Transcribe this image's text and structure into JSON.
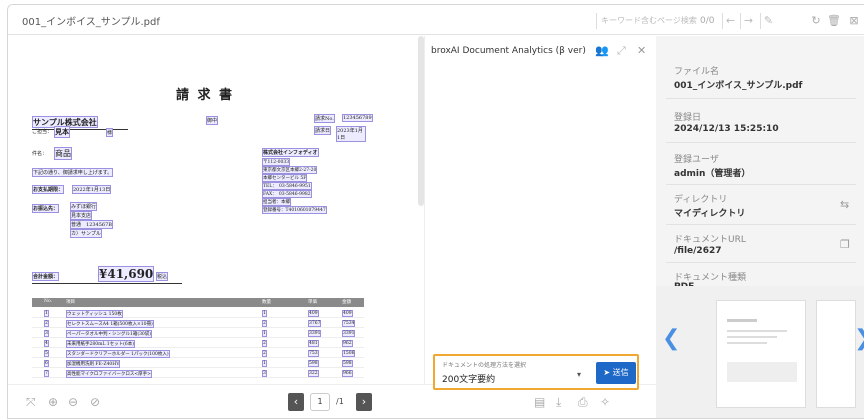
{
  "file_name": "001_インボイス_サンプル.pdf",
  "search": {
    "placeholder": "キーワード含むページ検索",
    "count": "0/0"
  },
  "doc": {
    "title": "請 求 書",
    "company": "サンプル株式会社",
    "company_suffix": "御中",
    "attn_label": "ご担当：",
    "attn_name": "見本",
    "attn_suffix": "様",
    "inv_no_label": "請求No.",
    "inv_no": "123456789",
    "inv_date_label": "請求日",
    "inv_date": "2023年1月1日",
    "subject_label": "件名：",
    "subject": "商品",
    "note": "下記の通り、御請求申し上げます。",
    "due_label": "お支払期限：",
    "due": "2022年1月13日",
    "bank_label": "お振込先：",
    "bank": [
      "みずほ銀行",
      "見本支店",
      "普通　1234567B",
      "カ）サンプル"
    ],
    "issuer": "株式会社インフォディオ",
    "issuer_lines": [
      "〒112-0033",
      "東京都文京区本郷2-27-20",
      "本郷センタービル 5F",
      "TEL：　03-5846-9951",
      "FAX：　03-5846-9982",
      "担当者：本郷",
      "登録番号：T4010601079447"
    ],
    "total_label": "合計金額：",
    "total": "¥41,690",
    "total_tax": "税込",
    "headers": [
      "No.",
      "項目",
      "数量",
      "単価",
      "金額"
    ],
    "rows": [
      [
        "1",
        "ウェットティッシュ 150枚",
        "1",
        "409",
        "409"
      ],
      [
        "2",
        "セレクトスムースA4 1箱(500枚入×10冊)",
        "2",
        "3767",
        "7534"
      ],
      [
        "3",
        "ペーパータオル中判・シングル1箱(30袋)",
        "1",
        "3391",
        "3391"
      ],
      [
        "4",
        "未来用紙手280mL 1セット(6本)",
        "2",
        "481",
        "962"
      ],
      [
        "5",
        "スタンダードクリアーホルダー 1パック(100枚入)",
        "2",
        "753",
        "1506"
      ],
      [
        "6",
        "加湿機用洗剤 FE-Z40HV",
        "1",
        "598",
        "598"
      ],
      [
        "7",
        "高性能マイクロファイバークロス<厚手>",
        "3",
        "322",
        "966"
      ]
    ]
  },
  "pager": {
    "current": "1",
    "total": "/1"
  },
  "ai": {
    "title": "broxAI Document Analytics (β ver)",
    "select_label": "ドキュメントの処理方法を選択",
    "select_value": "200文字要約",
    "send": "送信"
  },
  "info": {
    "file_label": "ファイル名",
    "file_value": "001_インボイス_サンプル.pdf",
    "reg_label": "登録日",
    "reg_value": "2024/12/13 15:25:10",
    "user_label": "登録ユーザ",
    "user_value": "admin（管理者）",
    "dir_label": "ディレクトリ",
    "dir_value": "マイディレクトリ",
    "url_label": "ドキュメントURL",
    "url_value": "/file/2627",
    "type_label": "ドキュメント種類",
    "type_value": "PDF"
  }
}
